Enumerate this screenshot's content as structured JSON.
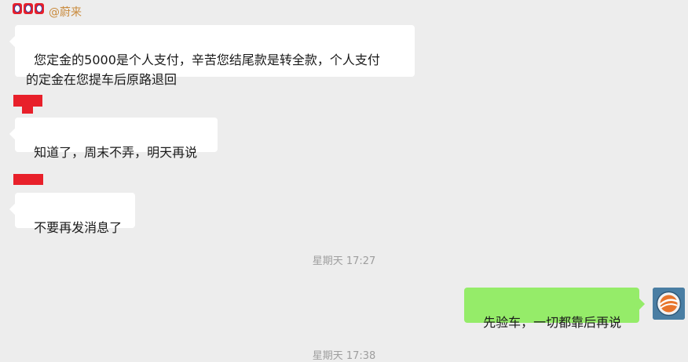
{
  "messages": [
    {
      "sender_suffix": "@蔚来",
      "text": "您定金的5000是个人支付，辛苦您结尾款是转全款，个人支付\n的定金在您提车后原路退回"
    },
    {
      "text": "知道了，周末不弄，明天再说"
    },
    {
      "text": "不要再发消息了"
    }
  ],
  "timestamps": [
    "星期天 17:27",
    "星期天 17:38"
  ],
  "my_message": {
    "text": "先验车，一切都靠后再说"
  },
  "colors": {
    "background": "#ededed",
    "incoming_bubble": "#ffffff",
    "outgoing_bubble": "#95ec69",
    "redaction": "#e8202a",
    "sender_name": "#c98a3c",
    "timestamp": "#9e9e9e"
  }
}
